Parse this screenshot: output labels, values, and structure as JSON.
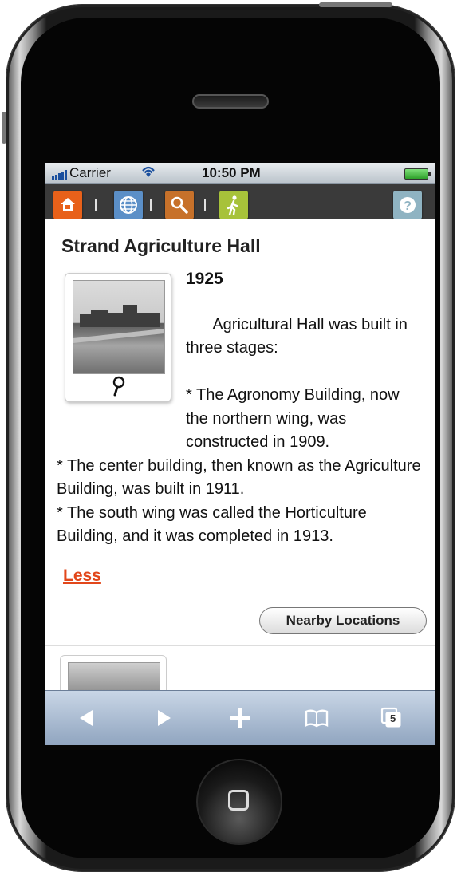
{
  "status": {
    "carrier": "Carrier",
    "time": "10:50 PM"
  },
  "toolbar": {
    "icons": [
      {
        "name": "home-icon",
        "color": "#e8611a"
      },
      {
        "name": "globe-icon",
        "color": "#5b8fc7"
      },
      {
        "name": "search-icon",
        "color": "#c7712a"
      },
      {
        "name": "walking-icon",
        "color": "#a7c23a"
      },
      {
        "name": "help-icon",
        "color": "#8fb3c2"
      }
    ]
  },
  "article": {
    "title": "Strand Agriculture Hall",
    "year": "1925",
    "body": "Agricultural Hall was built in three stages:\n\n* The Agronomy Building, now the northern wing, was constructed in 1909.\n* The center building, then known as the Agriculture Building, was built in 1911.\n* The south wing was called the Horticulture Building, and it was completed in 1913.",
    "less_label": "Less",
    "nearby_label": "Nearby Locations"
  },
  "browser_nav": {
    "back": "back-icon",
    "forward": "forward-icon",
    "add": "plus-icon",
    "bookmarks": "bookmarks-icon",
    "pages_count": "5"
  }
}
